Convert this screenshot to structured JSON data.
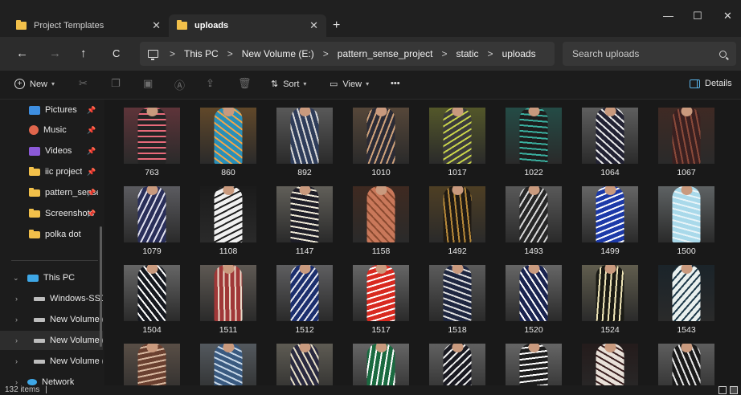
{
  "tabs": [
    {
      "label": "Project Templates",
      "active": false
    },
    {
      "label": "uploads",
      "active": true
    }
  ],
  "window_controls": {
    "minimize": "—",
    "maximize": "☐",
    "close": "✕"
  },
  "nav": {
    "back": "←",
    "forward": "→",
    "up": "↑",
    "refresh": "C"
  },
  "breadcrumb": [
    "This PC",
    "New Volume (E:)",
    "pattern_sense_project",
    "static",
    "uploads"
  ],
  "breadcrumb_sep": ">",
  "search": {
    "placeholder": "Search uploads"
  },
  "toolbar": {
    "new_label": "New",
    "sort_label": "Sort",
    "view_label": "View",
    "more_label": "•••",
    "details_label": "Details"
  },
  "sidebar": {
    "quick_access": [
      {
        "label": "Pictures",
        "icon": "pictures-icon",
        "pinned": true
      },
      {
        "label": "Music",
        "icon": "music-icon",
        "pinned": true
      },
      {
        "label": "Videos",
        "icon": "videos-icon",
        "pinned": true
      },
      {
        "label": "iic project",
        "icon": "folder-icon",
        "pinned": true
      },
      {
        "label": "pattern_sense",
        "icon": "folder-icon",
        "pinned": true
      },
      {
        "label": "Screenshots",
        "icon": "folder-icon",
        "pinned": true
      },
      {
        "label": "polka dot",
        "icon": "folder-icon",
        "pinned": false
      }
    ],
    "tree": [
      {
        "label": "This PC",
        "icon": "pc-icon",
        "expanded": true
      },
      {
        "label": "Windows-SSD",
        "icon": "drive-icon"
      },
      {
        "label": "New Volume (I",
        "icon": "drive-icon"
      },
      {
        "label": "New Volume (I",
        "icon": "drive-icon",
        "selected": true
      },
      {
        "label": "New Volume (I",
        "icon": "drive-icon"
      },
      {
        "label": "Network",
        "icon": "network-icon"
      }
    ]
  },
  "files": [
    {
      "name": "763",
      "color": "#242424",
      "accent": "#e86a7a"
    },
    {
      "name": "860",
      "color": "#2a8fb8",
      "accent": "#f0a64a"
    },
    {
      "name": "892",
      "color": "#2f3d5a",
      "accent": "#d8d8d8"
    },
    {
      "name": "1010",
      "color": "#2b2b35",
      "accent": "#cfa27a"
    },
    {
      "name": "1017",
      "color": "#3b3b3b",
      "accent": "#c8d34a"
    },
    {
      "name": "1022",
      "color": "#1d1d1d",
      "accent": "#3ab0a0"
    },
    {
      "name": "1064",
      "color": "#222233",
      "accent": "#e9e9e9"
    },
    {
      "name": "1067",
      "color": "#3a2020",
      "accent": "#8a4a3a"
    },
    {
      "name": "1079",
      "color": "#2a2f5a",
      "accent": "#e0e0ee"
    },
    {
      "name": "1108",
      "color": "#f0f0f0",
      "accent": "#1e1e1e"
    },
    {
      "name": "1147",
      "color": "#1e1e28",
      "accent": "#f0ead8"
    },
    {
      "name": "1158",
      "color": "#c9785a",
      "accent": "#8a4a30"
    },
    {
      "name": "1492",
      "color": "#1f1a14",
      "accent": "#b88a3a"
    },
    {
      "name": "1493",
      "color": "#262626",
      "accent": "#d8d8d8"
    },
    {
      "name": "1499",
      "color": "#1d3aa8",
      "accent": "#ffffff"
    },
    {
      "name": "1500",
      "color": "#a9d9ea",
      "accent": "#e8f4f8"
    },
    {
      "name": "1504",
      "color": "#15181f",
      "accent": "#ffffff"
    },
    {
      "name": "1511",
      "color": "#a03838",
      "accent": "#e8d8c8"
    },
    {
      "name": "1512",
      "color": "#1c2f6e",
      "accent": "#e8e8ee"
    },
    {
      "name": "1517",
      "color": "#d82a20",
      "accent": "#ffffff"
    },
    {
      "name": "1518",
      "color": "#1e2640",
      "accent": "#e0e0e0"
    },
    {
      "name": "1520",
      "color": "#1a2450",
      "accent": "#ffffff"
    },
    {
      "name": "1524",
      "color": "#1a1a14",
      "accent": "#f0e6b8"
    },
    {
      "name": "1543",
      "color": "#e9f0ee",
      "accent": "#1e3a4a"
    },
    {
      "name": "",
      "color": "#6a4030",
      "accent": "#d8b8a0"
    },
    {
      "name": "",
      "color": "#3a5a80",
      "accent": "#c8d8e8"
    },
    {
      "name": "",
      "color": "#2a2a40",
      "accent": "#e8e0c8"
    },
    {
      "name": "",
      "color": "#1a6a40",
      "accent": "#ffffff"
    },
    {
      "name": "",
      "color": "#1a1a22",
      "accent": "#f0f0f0"
    },
    {
      "name": "",
      "color": "#1e1e1e",
      "accent": "#ffffff"
    },
    {
      "name": "",
      "color": "#e8e0d8",
      "accent": "#3a2020"
    },
    {
      "name": "",
      "color": "#1a1a1a",
      "accent": "#e8e8e8"
    }
  ],
  "status": {
    "item_count": "132 items",
    "separator": "|"
  },
  "colors": {
    "folder": "#f2c04a",
    "accent": "#5ab3e8",
    "background": "#191919"
  }
}
